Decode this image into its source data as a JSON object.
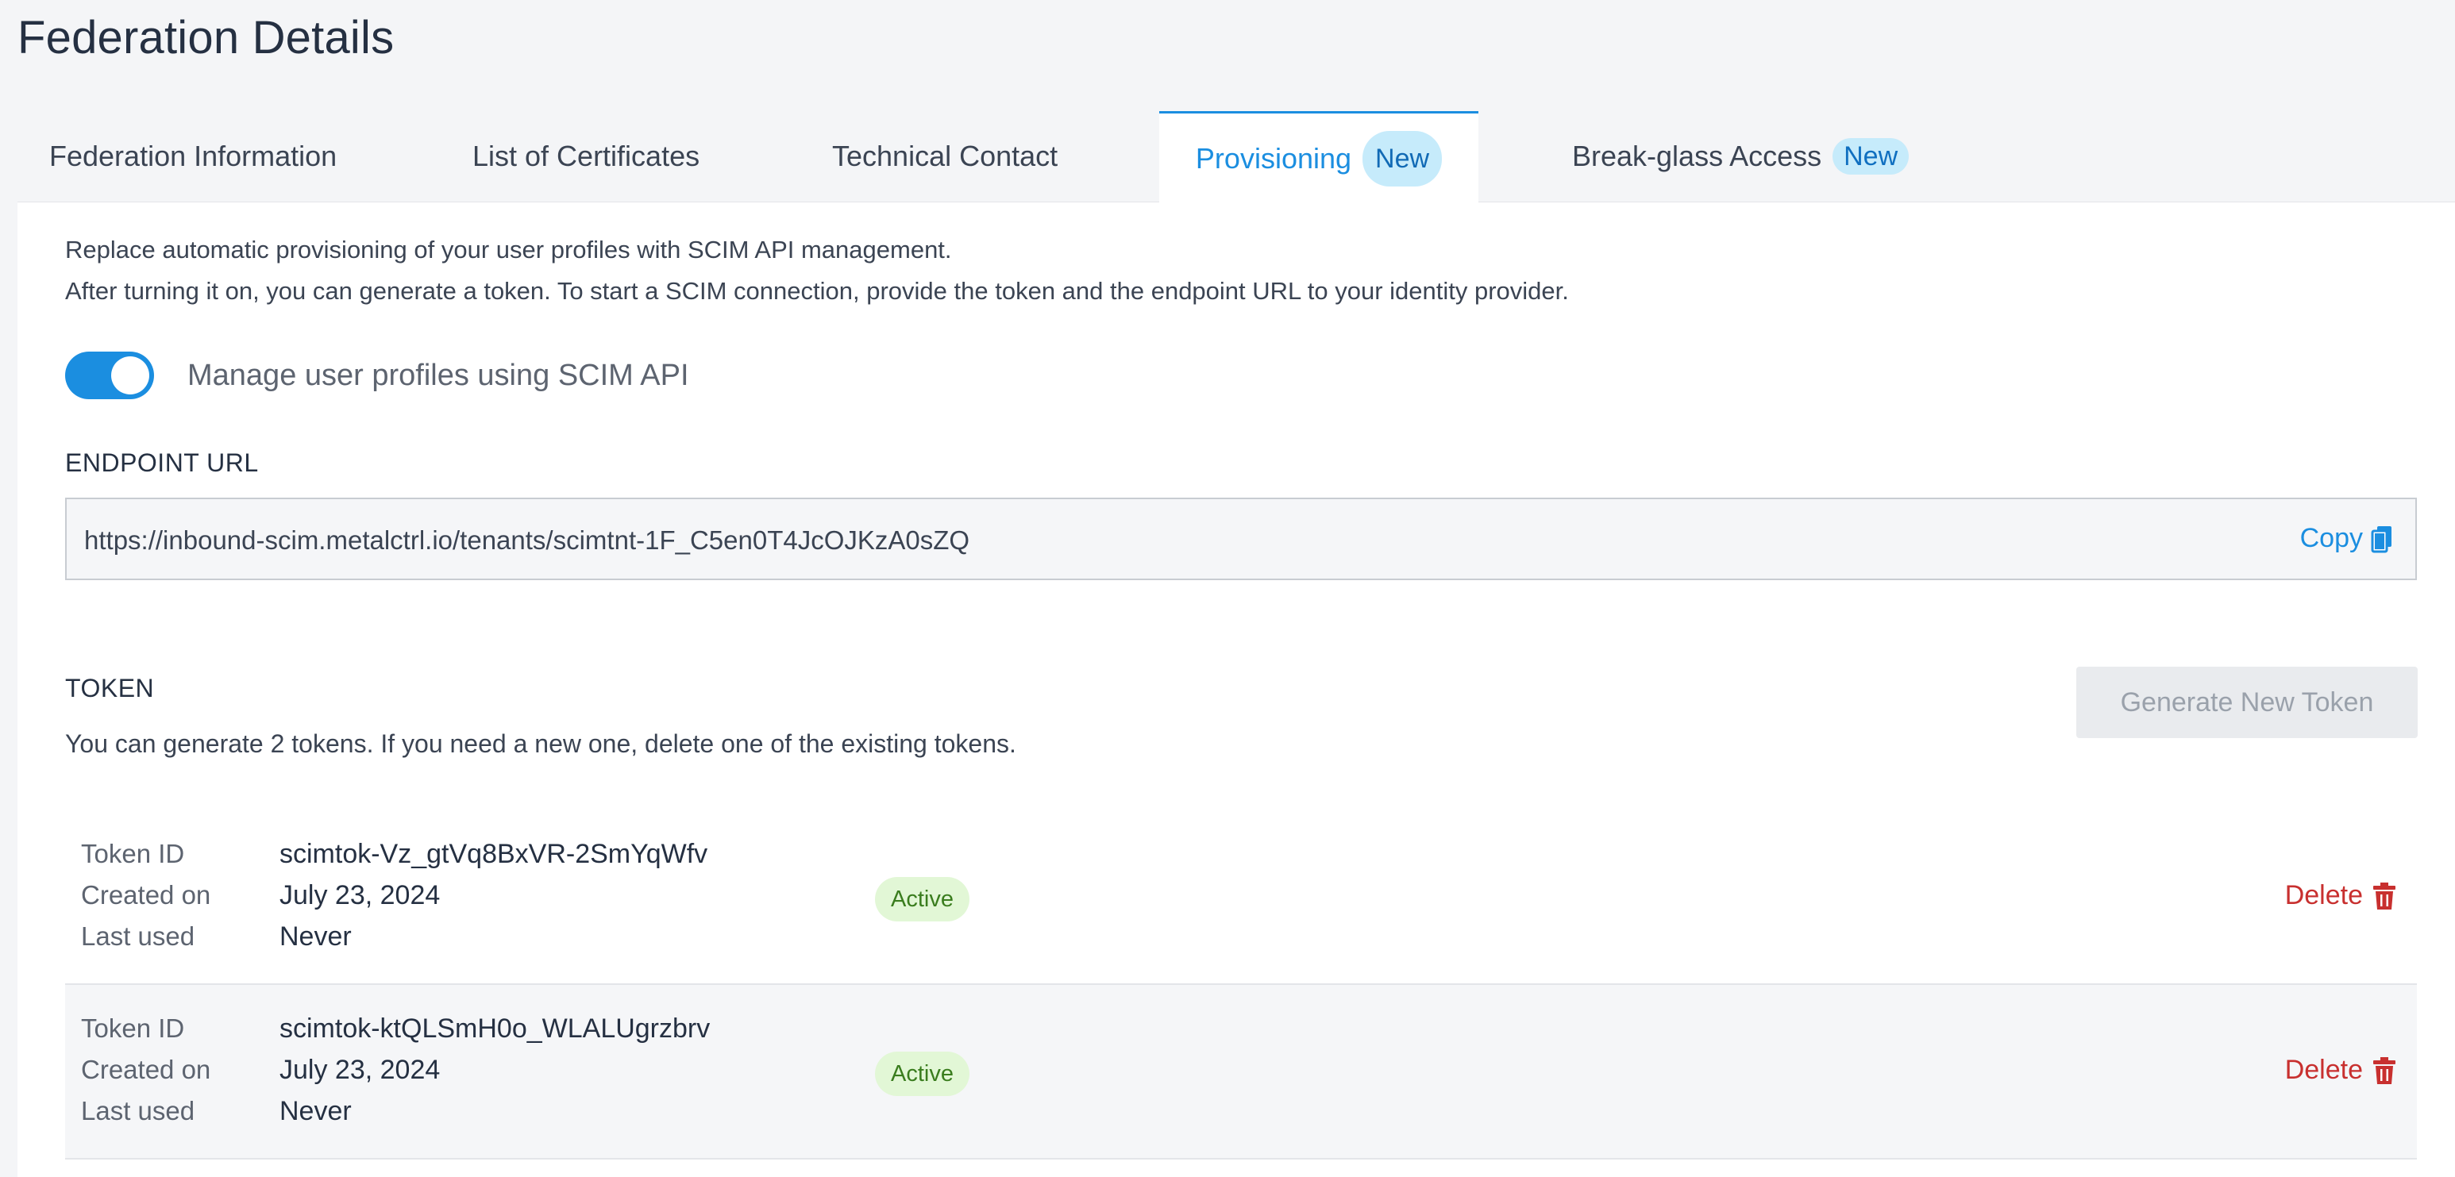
{
  "page": {
    "title": "Federation Details"
  },
  "tabs": [
    {
      "label": "Federation Information",
      "badge": ""
    },
    {
      "label": "List of Certificates",
      "badge": ""
    },
    {
      "label": "Technical Contact",
      "badge": ""
    },
    {
      "label": "Provisioning",
      "badge": "New",
      "active": true
    },
    {
      "label": "Break-glass Access",
      "badge": "New"
    }
  ],
  "provisioning": {
    "description_line1": "Replace automatic provisioning of your user profiles with SCIM API management.",
    "description_line2": "After turning it on, you can generate a token. To start a SCIM connection, provide the token and the endpoint URL to your identity provider.",
    "toggle_label": "Manage user profiles using SCIM API",
    "toggle_on": true,
    "endpoint_label": "ENDPOINT URL",
    "endpoint_value": "https://inbound-scim.metalctrl.io/tenants/scimtnt-1F_C5en0T4JcOJKzA0sZQ",
    "copy_label": "Copy",
    "token_label": "TOKEN",
    "token_help": "You can generate 2 tokens. If you need a new one, delete one of the existing tokens.",
    "generate_label": "Generate New Token",
    "field_labels": {
      "token_id": "Token ID",
      "created_on": "Created on",
      "last_used": "Last used"
    },
    "tokens": [
      {
        "id": "scimtok-Vz_gtVq8BxVR-2SmYqWfv",
        "created": "July 23, 2024",
        "last_used": "Never",
        "status": "Active",
        "delete_label": "Delete"
      },
      {
        "id": "scimtok-ktQLSmH0o_WLALUgrzbrv",
        "created": "July 23, 2024",
        "last_used": "Never",
        "status": "Active",
        "delete_label": "Delete"
      }
    ]
  },
  "colors": {
    "accent": "#1b8ee0",
    "danger": "#c8302f",
    "active_badge_bg": "#e2f7d6",
    "active_badge_text": "#3a7d1e"
  }
}
